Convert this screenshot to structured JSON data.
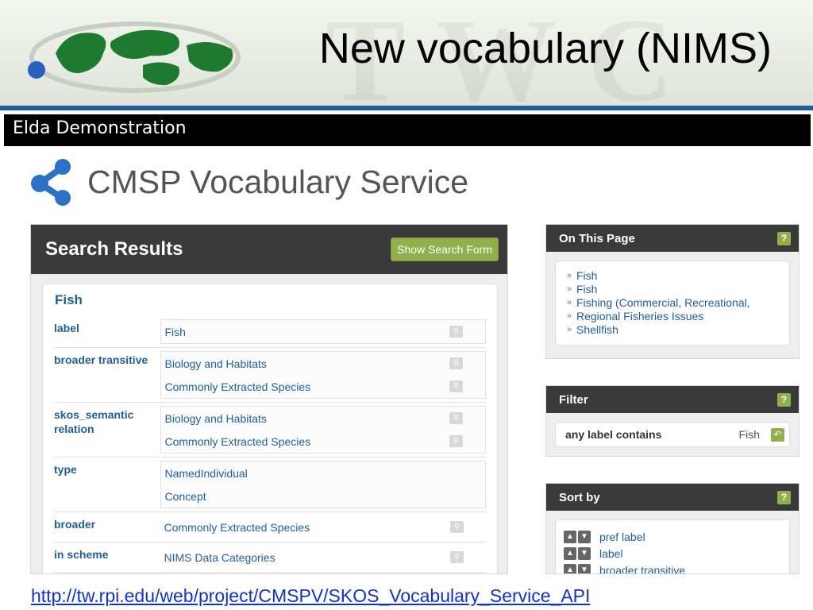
{
  "slide": {
    "title": "New vocabulary (NIMS)",
    "watermark": "TWC",
    "footer_link": "http://tw.rpi.edu/web/project/CMSPV/SKOS_Vocabulary_Service_API"
  },
  "app": {
    "bar_title": "Elda Demonstration",
    "brand_title": "CMSP Vocabulary Service"
  },
  "results": {
    "heading": "Search Results",
    "show_form_label": "Show Search Form",
    "item_title": "Fish",
    "properties": [
      {
        "name": "label",
        "values": [
          "Fish"
        ]
      },
      {
        "name": "broader transitive",
        "values": [
          "Biology and Habitats",
          "Commonly Extracted Species"
        ]
      },
      {
        "name": "skos_semantic relation",
        "values": [
          "Biology and Habitats",
          "Commonly Extracted Species"
        ]
      },
      {
        "name": "type",
        "values": [
          "NamedIndividual",
          "Concept"
        ]
      },
      {
        "name": "broader",
        "values": [
          "Commonly Extracted Species"
        ]
      },
      {
        "name": "in scheme",
        "values": [
          "NIMS Data Categories"
        ]
      }
    ]
  },
  "on_this_page": {
    "heading": "On This Page",
    "help": "?",
    "items": [
      "Fish",
      "Fish",
      "Fishing (Commercial, Recreational,",
      "Regional Fisheries Issues",
      "Shellfish"
    ]
  },
  "filter": {
    "heading": "Filter",
    "help": "?",
    "label": "any label contains",
    "value": "Fish"
  },
  "sort_by": {
    "heading": "Sort by",
    "help": "?",
    "items": [
      "pref label",
      "label",
      "broader transitive"
    ]
  },
  "colors": {
    "accent_green": "#8fb04a",
    "panel_dark": "#3a3a3a",
    "link_blue": "#1f5e9c",
    "header_rule": "#1f5e9c"
  }
}
